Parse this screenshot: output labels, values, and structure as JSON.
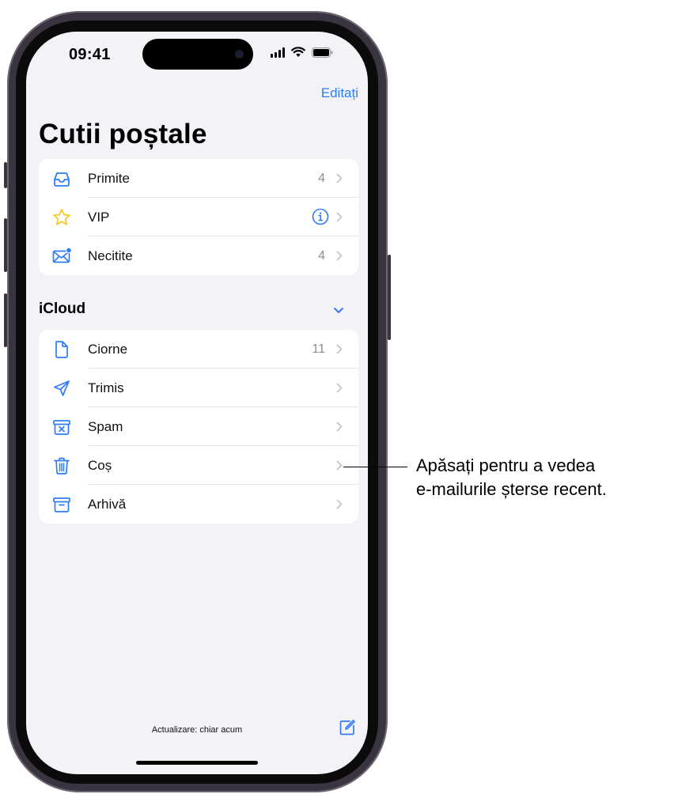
{
  "status_bar": {
    "time": "09:41"
  },
  "nav": {
    "edit_label": "Editați"
  },
  "page_title": "Cutii poștale",
  "favorites": [
    {
      "label": "Primite",
      "count": "4",
      "icon": "tray-icon"
    },
    {
      "label": "VIP",
      "count": "",
      "icon": "star-icon"
    },
    {
      "label": "Necitite",
      "count": "4",
      "icon": "unread-envelope-icon"
    }
  ],
  "icloud": {
    "header": "iCloud",
    "items": [
      {
        "label": "Ciorne",
        "count": "11",
        "icon": "draft-doc-icon"
      },
      {
        "label": "Trimis",
        "count": "",
        "icon": "paperplane-icon"
      },
      {
        "label": "Spam",
        "count": "",
        "icon": "junk-box-icon"
      },
      {
        "label": "Coș",
        "count": "",
        "icon": "trash-icon"
      },
      {
        "label": "Arhivă",
        "count": "",
        "icon": "archive-box-icon"
      }
    ]
  },
  "toolbar": {
    "update_status": "Actualizare: chiar acum"
  },
  "callout": {
    "line1": "Apăsați pentru a vedea",
    "line2": "e-mailurile șterse recent."
  },
  "colors": {
    "accent": "#2f7cf6",
    "background": "#f2f2f7",
    "star": "#f5c518"
  }
}
